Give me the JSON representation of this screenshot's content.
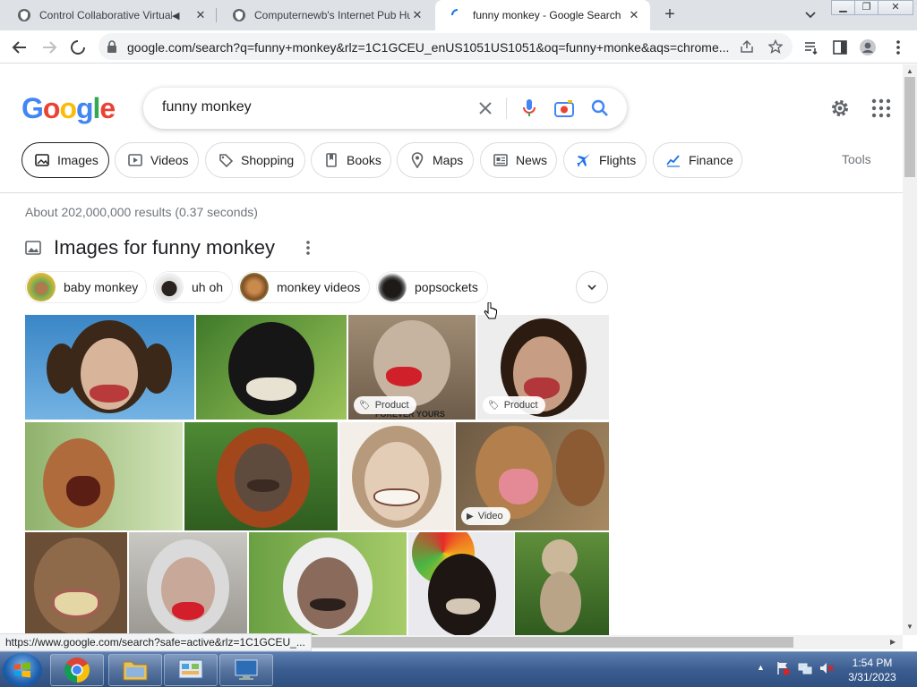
{
  "browser": {
    "tabs": [
      {
        "title": "Control Collaborative Virtual",
        "icon": "shield-icon",
        "muted": true
      },
      {
        "title": "Computernewb's Internet Pub Hu",
        "icon": "shield-icon"
      },
      {
        "title": "funny monkey - Google Search",
        "icon": "loading-spinner-icon",
        "active": true
      }
    ],
    "url": "google.com/search?q=funny+monkey&rlz=1C1GCEU_enUS1051US1051&oq=funny+monke&aqs=chrome...."
  },
  "google": {
    "logo": [
      "G",
      "o",
      "o",
      "g",
      "l",
      "e"
    ],
    "logo_colors": [
      "#4285F4",
      "#EA4335",
      "#FBBC05",
      "#4285F4",
      "#34A853",
      "#EA4335"
    ],
    "query": "funny monkey",
    "chips": [
      {
        "label": "Images",
        "icon": "image-icon",
        "selected": true
      },
      {
        "label": "Videos",
        "icon": "video-play-icon"
      },
      {
        "label": "Shopping",
        "icon": "tag-icon"
      },
      {
        "label": "Books",
        "icon": "book-icon"
      },
      {
        "label": "Maps",
        "icon": "map-pin-icon"
      },
      {
        "label": "News",
        "icon": "newspaper-icon"
      },
      {
        "label": "Flights",
        "icon": "airplane-icon"
      },
      {
        "label": "Finance",
        "icon": "finance-chart-icon"
      }
    ],
    "tools_label": "Tools",
    "stats": "About 202,000,000 results (0.37 seconds)",
    "images_heading": "Images for funny monkey",
    "related": [
      {
        "label": "baby monkey"
      },
      {
        "label": "uh oh"
      },
      {
        "label": "monkey videos"
      },
      {
        "label": "popsockets"
      }
    ],
    "image_badges": {
      "product": "Product",
      "video": "Video",
      "watermark": "FOREVER YOURS"
    }
  },
  "status_url": "https://www.google.com/search?safe=active&rlz=1C1GCEU_...",
  "taskbar": {
    "time": "1:54 PM",
    "date": "3/31/2023",
    "apps": [
      "chrome-icon",
      "file-explorer-icon",
      "control-panel-icon",
      "remote-desktop-icon"
    ]
  }
}
